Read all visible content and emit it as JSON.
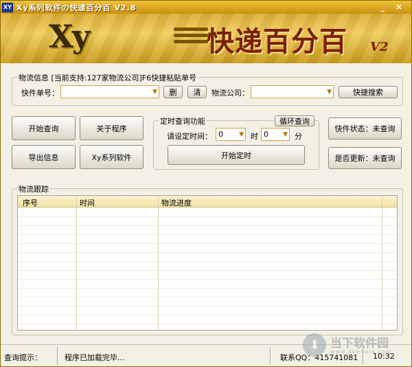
{
  "window": {
    "title": "Xy系列软件の快递百分百 V2.8",
    "icon_text": "XY",
    "minimize": "_",
    "close": "×"
  },
  "banner": {
    "logo": "Xy",
    "title": "快递百分百",
    "version": "V2"
  },
  "query_group": {
    "label": "物流信息 [当前支持:127家物流公司]F6快捷粘贴单号",
    "tracking_label": "快件单号：",
    "tracking_value": "",
    "delete_btn": "删",
    "clear_btn": "清",
    "company_label": "物流公司：",
    "company_value": "",
    "quick_search_btn": "快捷搜索"
  },
  "actions": {
    "start_query": "开始查询",
    "about": "关于程序",
    "export": "导出信息",
    "xy_software": "Xy系列软件"
  },
  "timer_group": {
    "label": "定时查询功能",
    "loop_btn": "循环查询",
    "set_time_label": "请设定时间：",
    "hour_value": "0",
    "hour_unit": "时",
    "minute_value": "0",
    "minute_unit": "分",
    "start_timer_btn": "开始定时"
  },
  "status_buttons": {
    "express_status": "快件状态：未查询",
    "updated": "是否更新：未查询"
  },
  "tracking_group": {
    "label": "物流跟踪",
    "columns": [
      "序号",
      "时间",
      "物流进度"
    ]
  },
  "statusbar": {
    "hint_label": "查询提示：",
    "message": "程序已加载完毕...",
    "contact": "联系QQ：415741081",
    "time": "10:32"
  },
  "watermark": {
    "text": "当下软件园",
    "sub": "www.downxia.com"
  },
  "colors": {
    "titlebar": "#d9a324",
    "banner_title": "#7a1f00",
    "combo_border": "#c8a24a"
  }
}
